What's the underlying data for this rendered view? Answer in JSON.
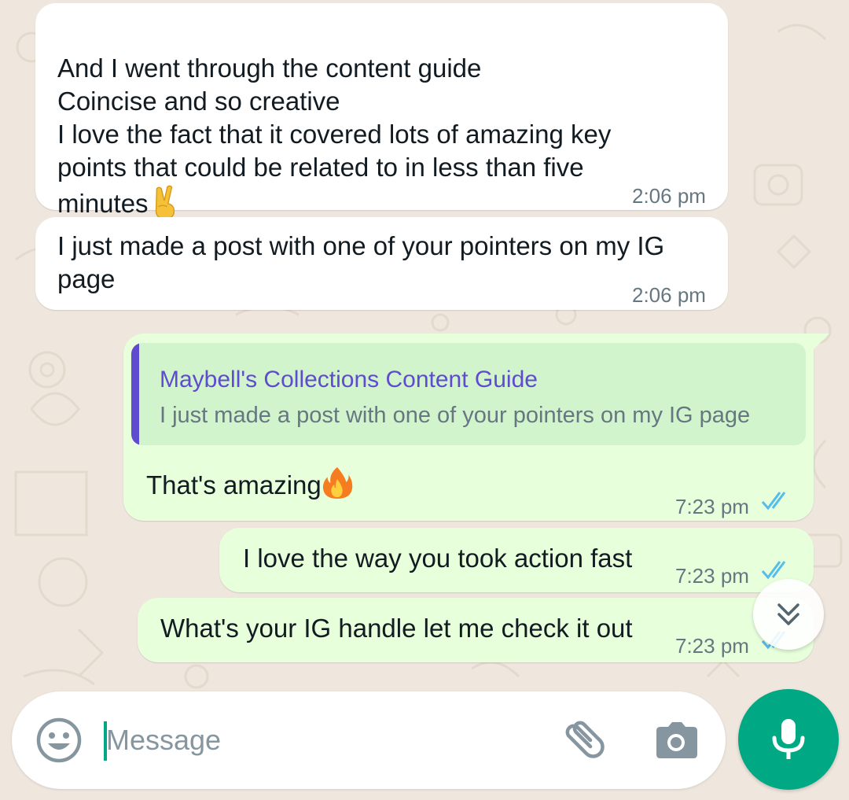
{
  "colors": {
    "background": "#efe7de",
    "incoming_bubble": "#ffffff",
    "outgoing_bubble": "#e7ffdb",
    "quote_accent": "#5f4bcf",
    "read_ticks": "#53bdeb",
    "send_green": "#00a884"
  },
  "messages": [
    {
      "direction": "incoming",
      "text": "And I went through the content guide\nCoincise and so creative\nI love the fact that it covered lots of amazing key\npoints that could be related to  in less than five\nminutes",
      "emoji": "victory-hand",
      "time": "2:06 pm"
    },
    {
      "direction": "incoming",
      "text": "I just made a post with one of your pointers on my IG\npage",
      "time": "2:06 pm"
    },
    {
      "direction": "outgoing",
      "quote": {
        "author": "Maybell's Collections Content Guide",
        "text": "I just made a post with one of your pointers on my IG page"
      },
      "text": "That's amazing",
      "emoji": "fire",
      "time": "7:23 pm",
      "status": "read"
    },
    {
      "direction": "outgoing",
      "text": "I love the way you took action fast",
      "time": "7:23 pm",
      "status": "read"
    },
    {
      "direction": "outgoing",
      "text": "What's your IG handle let me check it out",
      "time": "7:23 pm",
      "status": "read"
    }
  ],
  "composer": {
    "placeholder": "Message",
    "value": "",
    "icons": [
      "emoji-icon",
      "attach-icon",
      "camera-icon",
      "mic-icon"
    ]
  },
  "scroll_button_icon": "double-chevron-down-icon"
}
